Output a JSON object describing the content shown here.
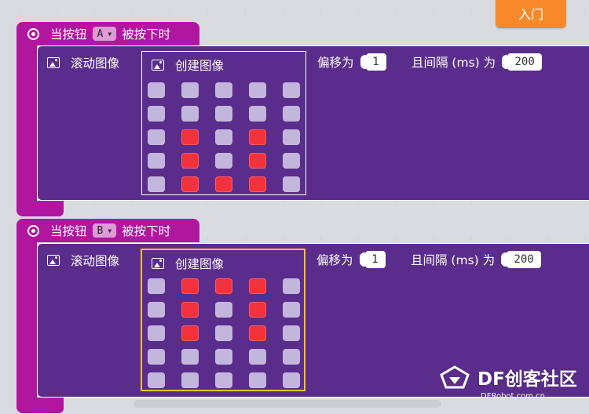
{
  "toolbar": {
    "entry_label": "入门"
  },
  "events": [
    {
      "prefix": "当按钮",
      "button": "A",
      "suffix": "被按下时",
      "scroll": {
        "label": "滚动图像",
        "create_label": "创建图像",
        "offset_label": "偏移为",
        "offset": "1",
        "interval_label": "且间隔 (ms) 为",
        "interval": "200",
        "leds": [
          [
            0,
            0,
            0,
            0,
            0
          ],
          [
            0,
            0,
            0,
            0,
            0
          ],
          [
            0,
            1,
            0,
            1,
            0
          ],
          [
            0,
            1,
            0,
            1,
            0
          ],
          [
            0,
            1,
            1,
            1,
            0
          ]
        ]
      }
    },
    {
      "prefix": "当按钮",
      "button": "B",
      "suffix": "被按下时",
      "scroll": {
        "label": "滚动图像",
        "create_label": "创建图像",
        "offset_label": "偏移为",
        "offset": "1",
        "interval_label": "且间隔 (ms) 为",
        "interval": "200",
        "leds": [
          [
            0,
            1,
            1,
            1,
            0
          ],
          [
            0,
            1,
            0,
            1,
            0
          ],
          [
            0,
            1,
            0,
            1,
            0
          ],
          [
            0,
            0,
            0,
            0,
            0
          ],
          [
            0,
            0,
            0,
            0,
            0
          ]
        ]
      }
    }
  ],
  "watermark": {
    "brand": "DF创客社区",
    "url": "DFRobot.com.cn"
  },
  "colors": {
    "event_block": "#b1169f",
    "scroll_block": "#5a2d8c",
    "led_on": "#f2333d",
    "led_off": "#c3b6dc",
    "selected_outline": "#f6c02e",
    "entry_button": "#f7892b"
  }
}
